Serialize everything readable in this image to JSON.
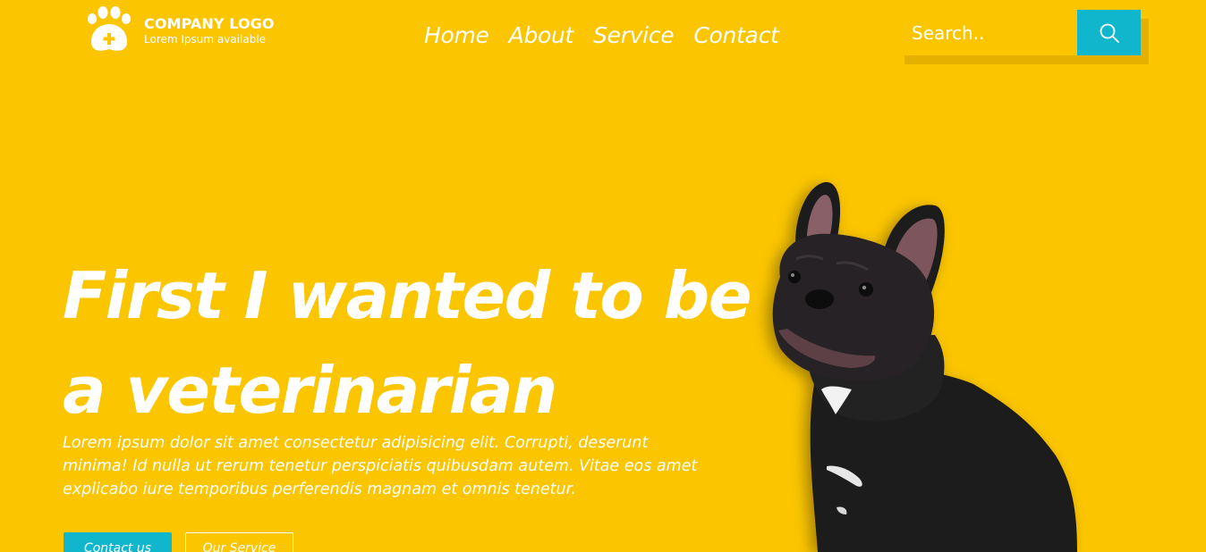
{
  "logo": {
    "title": "COMPANY LOGO",
    "subtitle": "Lorem Ipsum available",
    "icon": "paw-cross-icon"
  },
  "nav": {
    "items": [
      "Home",
      "About",
      "Service",
      "Contact"
    ]
  },
  "search": {
    "placeholder": "Search..",
    "icon": "search-icon"
  },
  "hero": {
    "title_line1": "First I wanted to be",
    "title_line2": "a veterinarian",
    "description": "Lorem ipsum dolor sit amet consectetur adipisicing elit. Corrupti, deserunt minima! Id nulla ut rerum tenetur perspiciatis quibusdam autem. Vitae eos amet explicabo iure temporibus perferendis magnam et omnis tenetur.",
    "buttons": {
      "contact": "Contact us",
      "service": "Our Service"
    },
    "image": "french-bulldog-photo"
  },
  "colors": {
    "background": "#fbc500",
    "accent": "#0fb6cc",
    "text": "#ffffff"
  }
}
